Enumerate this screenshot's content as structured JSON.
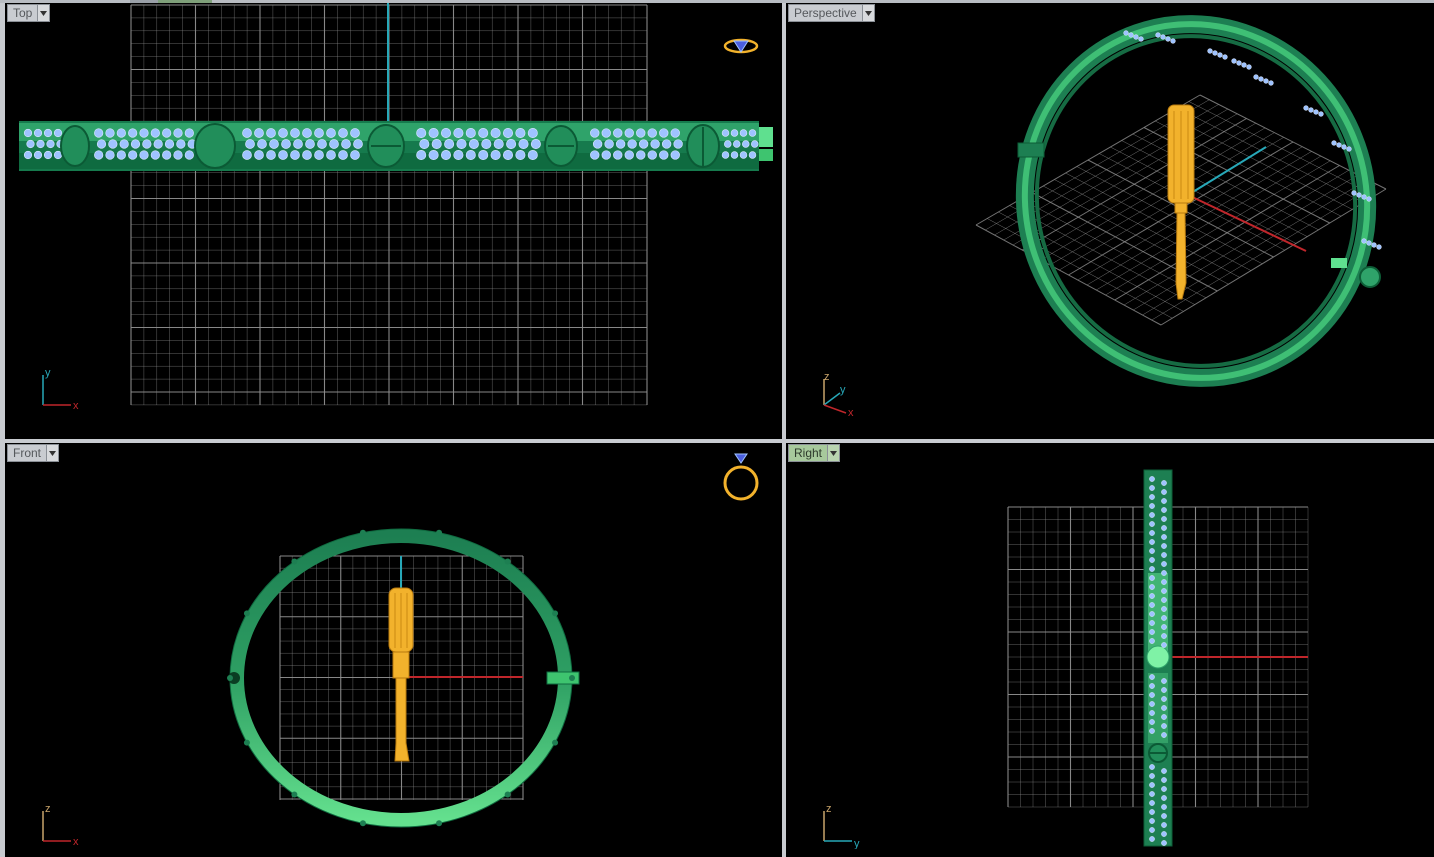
{
  "viewports": {
    "top": {
      "title": "Top"
    },
    "persp": {
      "title": "Perspective"
    },
    "front": {
      "title": "Front"
    },
    "right": {
      "title": "Right"
    }
  },
  "axis_labels": {
    "top": {
      "a": "y",
      "b": "x"
    },
    "persp": {
      "a": "z",
      "b": "y",
      "c": "x"
    },
    "front": {
      "a": "z",
      "b": "x"
    },
    "right": {
      "a": "z",
      "b": "y"
    }
  },
  "colors": {
    "viewport_bg": "#000000",
    "grid": "#8f8f8f",
    "band_dark": "#1d7f52",
    "band_light": "#5fe08f",
    "stones": "#9fc3ff",
    "screwdriver": "#f2b22c",
    "axis_x": "#c0262b",
    "axis_y": "#27a8b8",
    "active_tab": "#a7c99c"
  },
  "icons": {
    "viewport_menu": "dropdown-caret-icon",
    "top_corner": "ring-top-icon",
    "front_corner": "ring-front-icon",
    "axis_widget": "axis-gizmo-icon"
  }
}
